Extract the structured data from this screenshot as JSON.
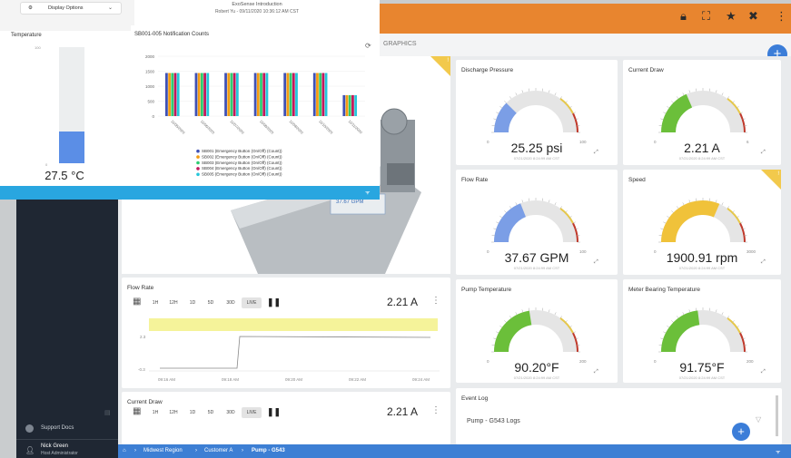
{
  "popup": {
    "display_options": "Display Options",
    "header_title": "ExoSense Introduction",
    "header_sub": "Robert Yu - 09/11/2020 10:36:12 AM CST",
    "temperature": {
      "title": "Temperature",
      "value": "27.5 °C",
      "axis_top": "100",
      "axis_bottom": "0",
      "level": 0.275
    },
    "bar_chart": {
      "title": "SB001-005 Notification Counts",
      "refresh_icon": "refresh-icon",
      "chart_data": {
        "type": "bar",
        "categories": [
          "11/05/2020",
          "11/06/2020",
          "11/07/2020",
          "11/08/2020",
          "11/09/2020",
          "11/10/2020",
          "11/11/2020"
        ],
        "series": [
          {
            "name": "SB001 (Emergency Button (On/Off) (Count))",
            "color": "#3f51b5",
            "values": [
              1440,
              1440,
              1440,
              1440,
              1440,
              1440,
              700
            ]
          },
          {
            "name": "SB002 (Emergency Button (On/Off) (Count))",
            "color": "#f39c12",
            "values": [
              1440,
              1440,
              1440,
              1440,
              1440,
              1440,
              700
            ]
          },
          {
            "name": "SB003 (Emergency Button (On/Off) (Count))",
            "color": "#2ecc71",
            "values": [
              1440,
              1440,
              1440,
              1440,
              1440,
              1440,
              700
            ]
          },
          {
            "name": "SB004 (Emergency Button (On/Off) (Count))",
            "color": "#c2185b",
            "values": [
              1440,
              1440,
              1440,
              1440,
              1440,
              1440,
              700
            ]
          },
          {
            "name": "SB005 (Emergency Button (On/Off) (Count))",
            "color": "#26c6da",
            "values": [
              1440,
              1440,
              1440,
              1440,
              1440,
              1440,
              700
            ]
          }
        ],
        "yticks": [
          "2000",
          "1500",
          "1000",
          "500",
          "0"
        ],
        "ylim": [
          0,
          2000
        ]
      }
    }
  },
  "topbar": {
    "icons": [
      "lock-icon",
      "fullscreen-icon",
      "star-icon",
      "tools-icon",
      "more-icon"
    ],
    "color": "#e8852f"
  },
  "subbar_tab": "GRAPHICS",
  "gauges": [
    {
      "title": "Discharge Pressure",
      "value": "25.25 psi",
      "ts": "07/21/2020 8:24:99 AM CST",
      "level": 0.25,
      "fill": "#7b9ee6",
      "min": "0",
      "max": "100",
      "warn": false
    },
    {
      "title": "Current Draw",
      "value": "2.21 A",
      "ts": "07/21/2020 8:24:99 AM CST",
      "level": 0.37,
      "fill": "#6bbf3a",
      "min": "0",
      "max": "6",
      "warn": false
    },
    {
      "title": "Flow Rate",
      "value": "37.67 GPM",
      "ts": "07/21/2020 8:24:99 AM CST",
      "level": 0.38,
      "fill": "#7b9ee6",
      "min": "0",
      "max": "100",
      "warn": false
    },
    {
      "title": "Speed",
      "value": "1900.91 rpm",
      "ts": "07/21/2020 8:24:99 AM CST",
      "level": 0.63,
      "fill": "#f0c23a",
      "min": "0",
      "max": "3000",
      "warn": true
    },
    {
      "title": "Pump Temperature",
      "value": "90.20°F",
      "ts": "07/21/2020 8:24:99 AM CST",
      "level": 0.45,
      "fill": "#6bbf3a",
      "min": "0",
      "max": "200",
      "warn": false
    },
    {
      "title": "Meter Bearing Temperature",
      "value": "91.75°F",
      "ts": "07/21/2020 8:24:99 AM CST",
      "level": 0.46,
      "fill": "#6bbf3a",
      "min": "0",
      "max": "200",
      "warn": false
    }
  ],
  "equipment": {
    "tag": "37.67 GPM"
  },
  "trend1": {
    "title": "Flow Rate",
    "value": "2.21 A",
    "ranges": [
      "1H",
      "12H",
      "1D",
      "5D",
      "30D",
      "LIVE"
    ],
    "chart_data": {
      "type": "line",
      "x": [
        "09:16 AM",
        "09:18 AM",
        "09:20 AM",
        "09:22 AM",
        "09:24 AM"
      ],
      "y_labels": [
        "2.3",
        "-0.3"
      ],
      "level_before": 0.0,
      "level_after": 2.3
    }
  },
  "trend2": {
    "title": "Current Draw",
    "value": "2.21 A",
    "ranges": [
      "1H",
      "12H",
      "1D",
      "5D",
      "30D",
      "LIVE"
    ]
  },
  "event_log": {
    "title": "Event Log",
    "row": "Pump - G543 Logs"
  },
  "sidebar": {
    "support": "Support Docs",
    "user_name": "Nick Green",
    "user_role": "Host Administrator"
  },
  "breadcrumb": [
    "Midwest Region",
    "Customer A",
    "Pump - G543"
  ]
}
